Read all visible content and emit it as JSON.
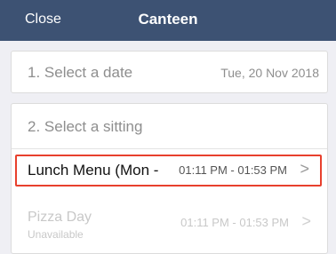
{
  "header": {
    "close_label": "Close",
    "title": "Canteen"
  },
  "step1": {
    "label": "1. Select a date",
    "value": "Tue, 20 Nov 2018"
  },
  "step2": {
    "label": "2. Select a sitting",
    "sittings": [
      {
        "name": "Lunch Menu (Mon -",
        "time": "01:11 PM - 01:53 PM",
        "chevron": ">"
      },
      {
        "name": "Pizza Day",
        "status": "Unavailable",
        "time": "01:11 PM - 01:53 PM",
        "chevron": ">"
      }
    ]
  },
  "colors": {
    "header_bg": "#3d5273",
    "highlight_border": "#e8402d"
  }
}
